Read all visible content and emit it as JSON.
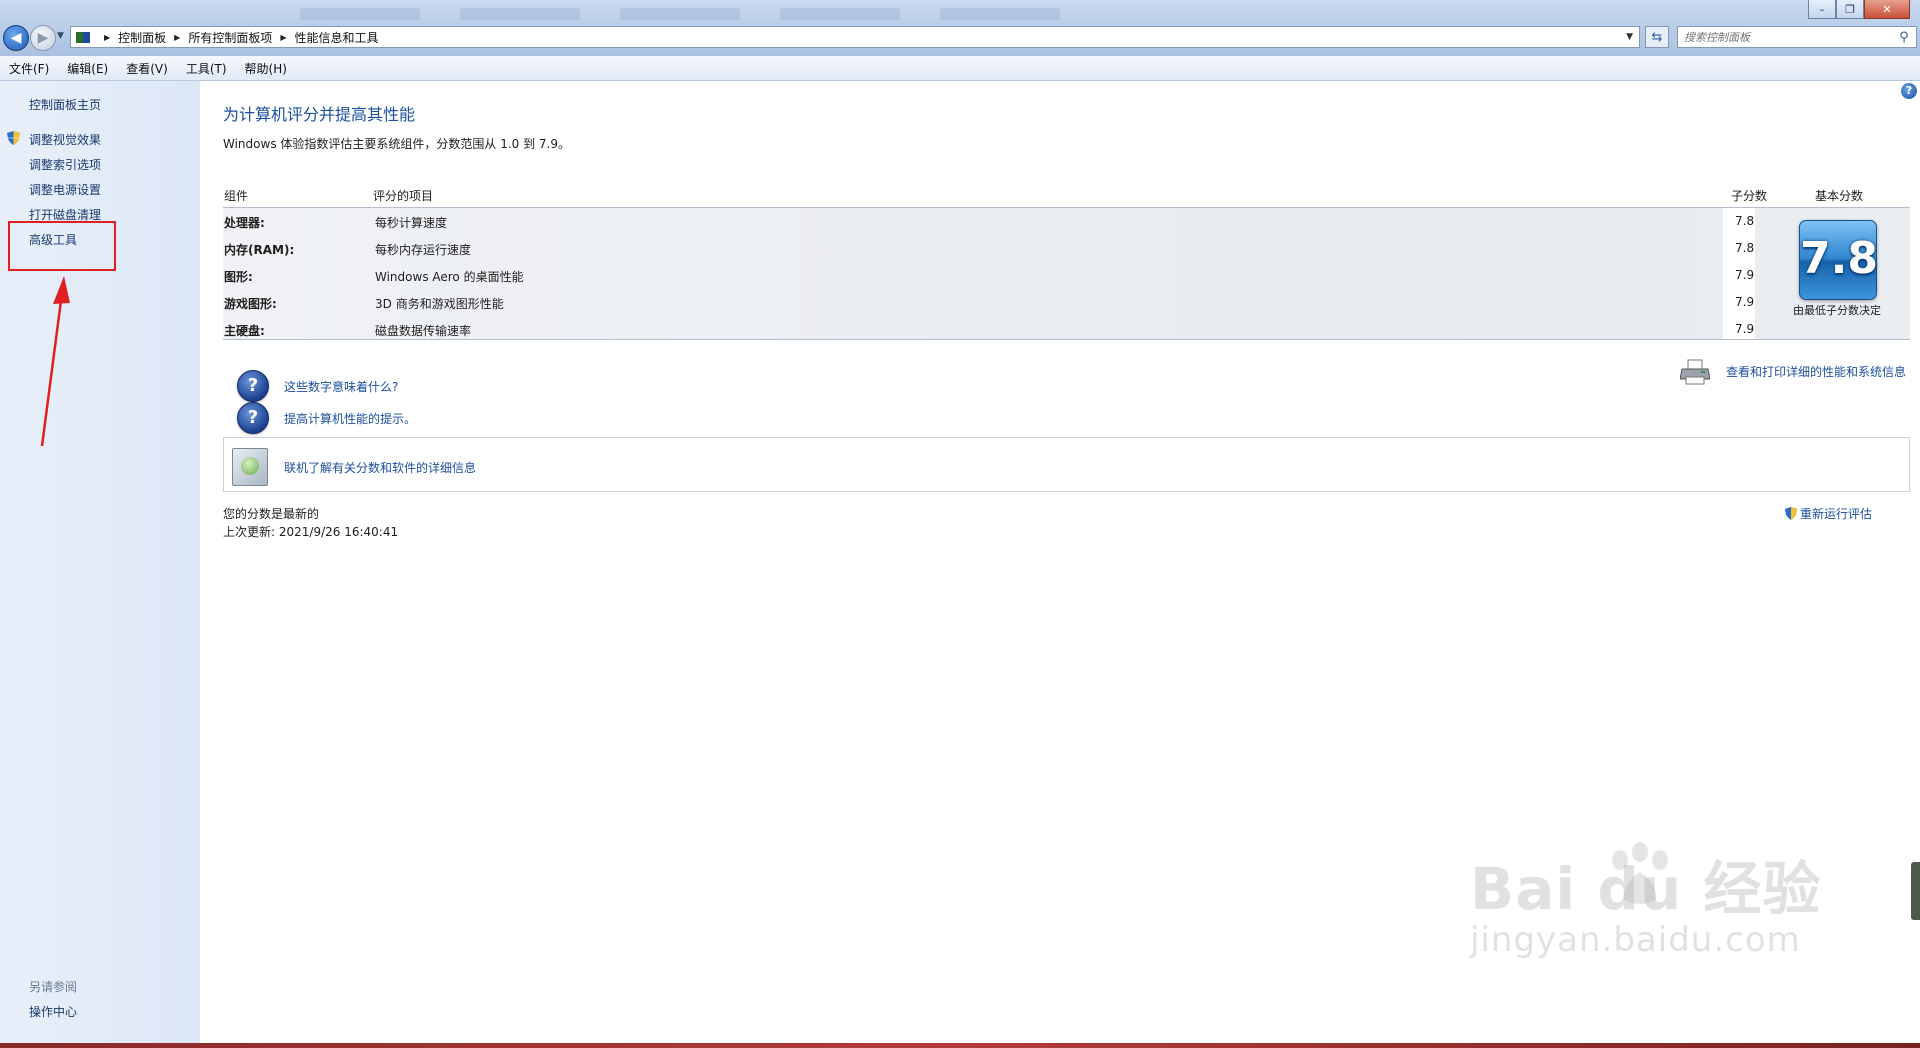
{
  "address_bar": {
    "crumbs": [
      "控制面板",
      "所有控制面板项",
      "性能信息和工具"
    ]
  },
  "search": {
    "placeholder": "搜索控制面板"
  },
  "menu": [
    "文件(F)",
    "编辑(E)",
    "查看(V)",
    "工具(T)",
    "帮助(H)"
  ],
  "sidebar": {
    "home": "控制面板主页",
    "items": [
      "调整视觉效果",
      "调整索引选项",
      "调整电源设置",
      "打开磁盘清理",
      "高级工具"
    ],
    "see_also_title": "另请参阅",
    "see_also_items": [
      "操作中心"
    ]
  },
  "main": {
    "title": "为计算机评分并提高其性能",
    "subtitle": "Windows 体验指数评估主要系统组件，分数范围从 1.0 到 7.9。",
    "headers": {
      "component": "组件",
      "rated": "评分的项目",
      "subscore": "子分数",
      "base": "基本分数"
    },
    "rows": [
      {
        "component": "处理器:",
        "rated": "每秒计算速度",
        "subscore": "7.8"
      },
      {
        "component": "内存(RAM):",
        "rated": "每秒内存运行速度",
        "subscore": "7.8"
      },
      {
        "component": "图形:",
        "rated": "Windows Aero 的桌面性能",
        "subscore": "7.9"
      },
      {
        "component": "游戏图形:",
        "rated": "3D 商务和游戏图形性能",
        "subscore": "7.9"
      },
      {
        "component": "主硬盘:",
        "rated": "磁盘数据传输速率",
        "subscore": "7.9"
      }
    ],
    "base_score": "7.8",
    "base_caption": "由最低子分数决定",
    "links": {
      "what_mean": "这些数字意味着什么?",
      "tips": "提高计算机性能的提示。",
      "print": "查看和打印详细的性能和系统信息",
      "online": "联机了解有关分数和软件的详细信息"
    },
    "status_current": "您的分数是最新的",
    "status_last_update": "上次更新: 2021/9/26 16:40:41",
    "rerun": "重新运行评估"
  },
  "watermark": {
    "main": "Bai du 经验",
    "url": "jingyan.baidu.com"
  }
}
